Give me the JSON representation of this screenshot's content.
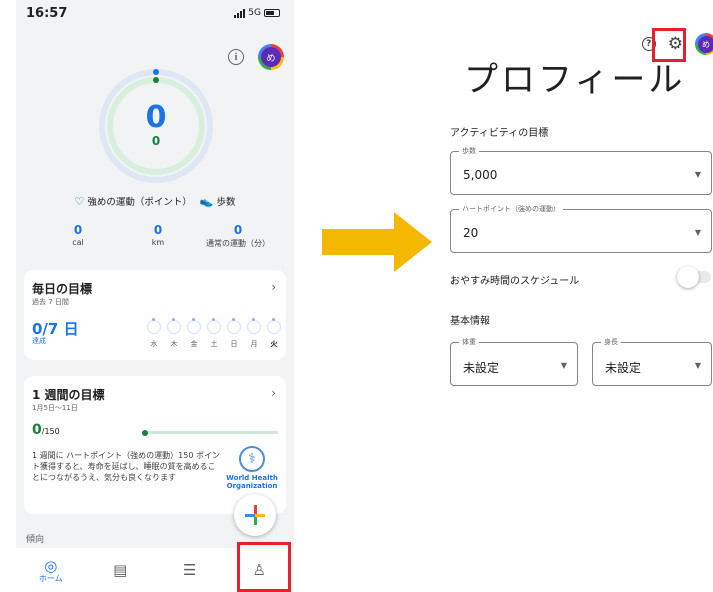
{
  "phone": {
    "status": {
      "time": "16:57",
      "network": "5G"
    },
    "ring": {
      "main_value": "0",
      "sub_value": "0"
    },
    "legend": {
      "heart_points": "強めの運動（ポイント）",
      "steps": "歩数"
    },
    "metrics": [
      {
        "value": "0",
        "label": "cal"
      },
      {
        "value": "0",
        "label": "km"
      },
      {
        "value": "0",
        "label": "通常の運動（分）"
      }
    ],
    "daily_goal": {
      "title": "毎日の目標",
      "subtitle": "過去 7 日間",
      "value": "0/7 日",
      "value_label": "達成",
      "days": [
        "水",
        "木",
        "金",
        "土",
        "日",
        "月",
        "火"
      ]
    },
    "weekly_goal": {
      "title": "1 週間の目標",
      "subtitle": "1月5日～11日",
      "value": "0",
      "target": "/150",
      "progress": 0,
      "description": "1 週間に ハートポイント（強めの運動）150 ポイント獲得すると、寿命を延ばし、睡眠の質を高めることにつながるうえ、気分も良くなります",
      "who_text": "World Health Organization"
    },
    "trend_label": "傾向",
    "nav": {
      "home_label": "ホーム"
    }
  },
  "profile": {
    "title": "プロフィール",
    "activity_goals_label": "アクティビティの目標",
    "steps_field": {
      "label": "歩数",
      "value": "5,000"
    },
    "heart_field": {
      "label": "ハートポイント（強めの運動）",
      "value": "20"
    },
    "bedtime_label": "おやすみ時間のスケジュール",
    "bedtime_enabled": false,
    "basic_info_label": "基本情報",
    "weight_field": {
      "label": "体重",
      "value": "未設定"
    },
    "height_field": {
      "label": "身長",
      "value": "未設定"
    },
    "avatar_initial": "め"
  },
  "colors": {
    "highlight": "#e8202a",
    "arrow": "#f5b800",
    "accent_blue": "#1a73e8",
    "accent_green": "#188038"
  }
}
